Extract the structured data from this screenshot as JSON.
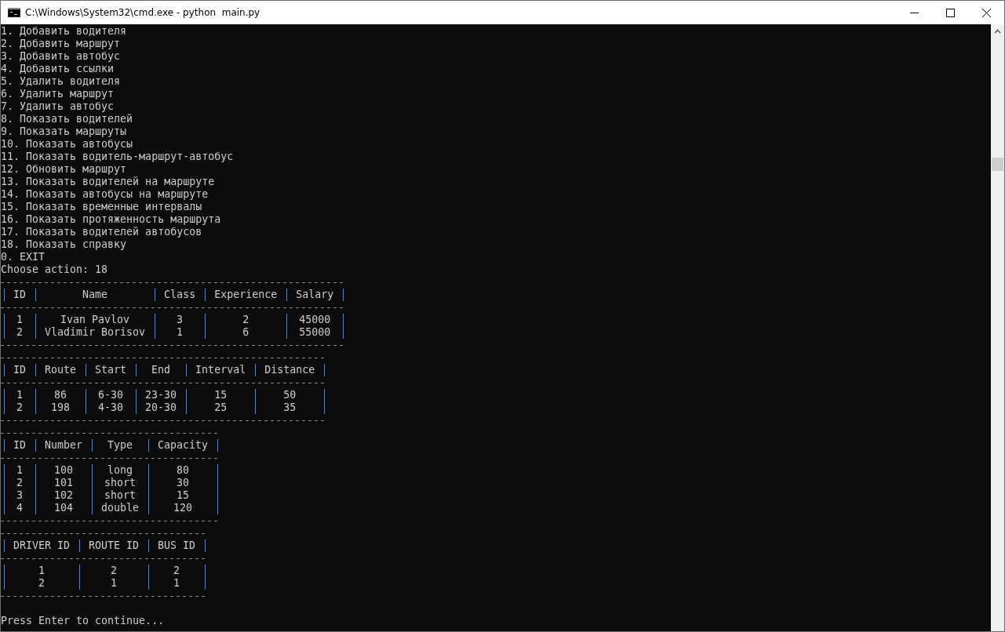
{
  "window": {
    "title": "C:\\Windows\\System32\\cmd.exe - python  main.py"
  },
  "menu": [
    "1. Добавить водителя",
    "2. Добавить маршрут",
    "3. Добавить автобус",
    "4. Добавить ссылки",
    "5. Удалить водителя",
    "6. Удалить маршрут",
    "7. Удалить автобус",
    "8. Показать водителей",
    "9. Показать маршруты",
    "10. Показать автобусы",
    "11. Показать водитель-маршрут-автобус",
    "12. Обновить маршрут",
    "13. Показать водителей на маршруте",
    "14. Показать автобусы на маршруте",
    "15. Показать временные интервалы",
    "16. Показать протяженность маршрута",
    "17. Показать водителей автобусов",
    "18. Показать справку",
    "0. EXIT"
  ],
  "prompt": "Choose action: 18",
  "tables": [
    {
      "columns": [
        "ID",
        "Name",
        "Class",
        "Experience",
        "Salary"
      ],
      "rows": [
        [
          "1",
          "Ivan Pavlov",
          "3",
          "2",
          "45000"
        ],
        [
          "2",
          "Vladimir Borisov",
          "1",
          "6",
          "55000"
        ]
      ]
    },
    {
      "columns": [
        "ID",
        "Route",
        "Start",
        "End",
        "Interval",
        "Distance"
      ],
      "rows": [
        [
          "1",
          "86",
          "6-30",
          "23-30",
          "15",
          "50"
        ],
        [
          "2",
          "198",
          "4-30",
          "20-30",
          "25",
          "35"
        ]
      ]
    },
    {
      "columns": [
        "ID",
        "Number",
        "Type",
        "Capacity"
      ],
      "rows": [
        [
          "1",
          "100",
          "long",
          "80"
        ],
        [
          "2",
          "101",
          "short",
          "30"
        ],
        [
          "3",
          "102",
          "short",
          "15"
        ],
        [
          "4",
          "104",
          "double",
          "120"
        ]
      ]
    },
    {
      "columns": [
        "DRIVER ID",
        "ROUTE ID",
        "BUS ID"
      ],
      "rows": [
        [
          "1",
          "2",
          "2"
        ],
        [
          "2",
          "1",
          "1"
        ]
      ]
    }
  ],
  "footer": "Press Enter to continue..."
}
